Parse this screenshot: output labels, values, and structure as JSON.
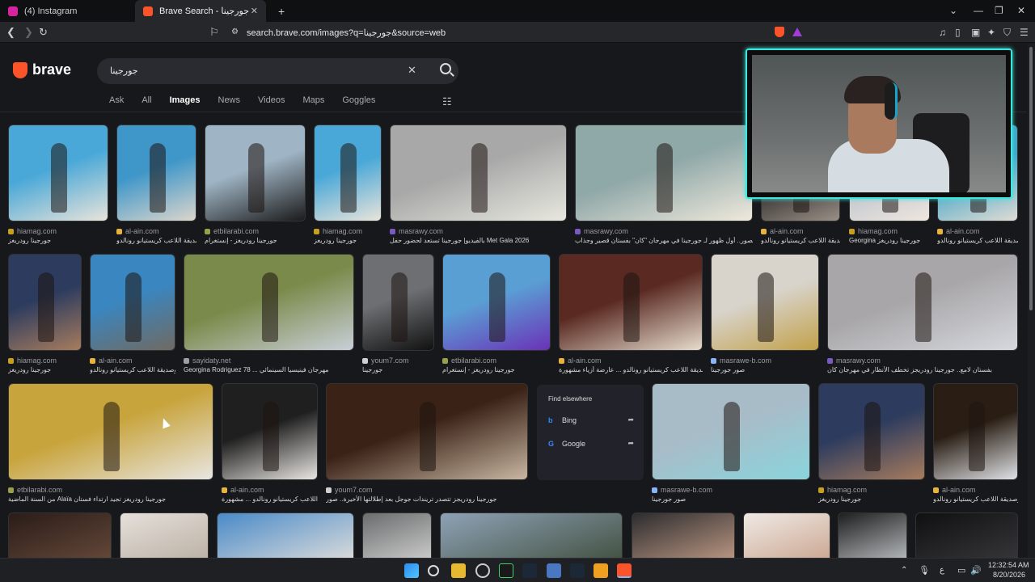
{
  "browser": {
    "tabs": [
      {
        "label": "(4) Instagram",
        "fav_color": "#d6249f"
      },
      {
        "label": "Brave Search - جورجينا",
        "fav_color": "#fb542b"
      }
    ],
    "url": "search.brave.com/images?q=جورجينا&source=web"
  },
  "search": {
    "logo": "brave",
    "query": "جورجينا",
    "tabs": [
      "Ask",
      "All",
      "Images",
      "News",
      "Videos",
      "Maps",
      "Goggles"
    ],
    "active_tab": "Images"
  },
  "results": [
    {
      "source": "hiamag.com",
      "title": "جورجينا رودريغز",
      "fav": "#c8a01e",
      "colors": [
        "#4aa8d8",
        "#e9e4da"
      ]
    },
    {
      "source": "al-ain.com",
      "title": "وصديقة اللاعب كريستيانو رونالدو",
      "fav": "#e8b33c",
      "colors": [
        "#3e96c9",
        "#dcd6cc"
      ]
    },
    {
      "source": "etbilarabi.com",
      "title": "جورجينا رودريغز - إنستغرام",
      "fav": "#9aa04a",
      "colors": [
        "#9fb4c4",
        "#1b1b1b"
      ]
    },
    {
      "source": "hiamag.com",
      "title": "جورجينا رودريغز",
      "fav": "#c8a01e",
      "colors": [
        "#4aa8d8",
        "#e9e4da"
      ]
    },
    {
      "source": "masrawy.com",
      "title": "بالفيديو| جورجينا تستعد لحضور حفل Met Gala 2026",
      "fav": "#7a5ac2",
      "colors": [
        "#a8a8a8",
        "#e8e8e0"
      ]
    },
    {
      "source": "masrawy.com",
      "title": "بالصور.. أول ظهور لـ جورجينا في مهرجان \"كان\" بفستان قصير وجذاب",
      "fav": "#7a5ac2",
      "colors": [
        "#8fa8a8",
        "#efe9dc"
      ]
    },
    {
      "source": "al-ain.com",
      "title": "وصديقة اللاعب كريستيانو رونالدو",
      "fav": "#e8b33c",
      "colors": [
        "#222222",
        "#9a8f86"
      ]
    },
    {
      "source": "hiamag.com",
      "title": "Georgina جورجينا رودريغز",
      "fav": "#c8a01e",
      "colors": [
        "#b8c0cc",
        "#efe6de"
      ]
    },
    {
      "source": "al-ain.com",
      "title": "وصديقة اللاعب كريستيانو رونالدو",
      "fav": "#e8b33c",
      "colors": [
        "#3ea4c8",
        "#e0dcd4"
      ]
    },
    {
      "source": "hiamag.com",
      "title": "جورجينا رودريغز",
      "fav": "#c8a01e",
      "colors": [
        "#2c3b5e",
        "#a77c5e"
      ]
    },
    {
      "source": "al-ain.com",
      "title": "وصديقة اللاعب كريستيانو رونالدو ...",
      "fav": "#e8b33c",
      "colors": [
        "#3a86c0",
        "#6f6a62"
      ]
    },
    {
      "source": "sayidaty.net",
      "title": "Georgina Rodriguez 78 ... مهرجان فينيسيا السينمائي",
      "fav": "#9aa0a6",
      "colors": [
        "#7a8a4a",
        "#c9cfd8"
      ]
    },
    {
      "source": "youm7.com",
      "title": "جورجينا",
      "fav": "#d0d0d0",
      "colors": [
        "#6d6f72",
        "#111111"
      ]
    },
    {
      "source": "etbilarabi.com",
      "title": "جورجينا رودريغز - إنستغرام",
      "fav": "#9aa04a",
      "colors": [
        "#5a9fd4",
        "#6a32b8"
      ]
    },
    {
      "source": "al-ain.com",
      "title": "وصديقة اللاعب كريستيانو رونالدو ... عارضة أزياء مشهورة",
      "fav": "#e8b33c",
      "colors": [
        "#5a2a22",
        "#e6dccd"
      ]
    },
    {
      "source": "masrawe-b.com",
      "title": "صور جورجينا",
      "fav": "#8ab4f8",
      "colors": [
        "#d8d4cc",
        "#c2a14a"
      ]
    },
    {
      "source": "masrawy.com",
      "title": "بفستان لامع.. جورجينا رودريجز تخطف الأنظار في مهرجان كان",
      "fav": "#7a5ac2",
      "colors": [
        "#a8a6a8",
        "#d6d8de"
      ]
    },
    {
      "source": "etbilarabi.com",
      "title": "من السنة الماضية Alaïa جورجينا رودريغز تجيد ارتداء فستان",
      "fav": "#9aa04a",
      "colors": [
        "#c8a43c",
        "#e8e6e2"
      ]
    },
    {
      "source": "al-ain.com",
      "title": "وصديقة اللاعب كريستيانو رونالدو ... مشهورة",
      "fav": "#e8b33c",
      "colors": [
        "#1f1f1f",
        "#e9e6e2"
      ]
    },
    {
      "source": "youm7.com",
      "title": "جورجينا رودريجز تتصدر تريندات جوجل بعد إطلالتها الأخيرة.. صور",
      "fav": "#d0d0d0",
      "colors": [
        "#3a2216",
        "#c8b6a2"
      ]
    },
    {
      "source": "masrawe-b.com",
      "title": "صور جورجينا",
      "fav": "#8ab4f8",
      "colors": [
        "#a8bcc8",
        "#8ad4dc"
      ]
    },
    {
      "source": "hiamag.com",
      "title": "جورجينا رودريغز",
      "fav": "#c8a01e",
      "colors": [
        "#2c3b5e",
        "#a77c5e"
      ]
    },
    {
      "source": "al-ain.com",
      "title": "وصديقة اللاعب كريستيانو رونالدو",
      "fav": "#e8b33c",
      "colors": [
        "#2a1e14",
        "#e0e2e6"
      ]
    }
  ],
  "find_elsewhere": {
    "title": "Find elsewhere",
    "items": [
      {
        "label": "Bing",
        "icon": "b"
      },
      {
        "label": "Google",
        "icon": "G"
      }
    ]
  },
  "bottom_row_colors": [
    [
      "#2a1c18",
      "#6a4c3c"
    ],
    [
      "#e4e0da",
      "#b8aca0"
    ],
    [
      "#4a8ac8",
      "#e6e2dc"
    ],
    [
      "#6a6c6e",
      "#d6d6d4"
    ],
    [
      "#8ea2b6",
      "#3e4c3a"
    ],
    [
      "#2c2c2e",
      "#c8a08a"
    ],
    [
      "#efeae4",
      "#c8a08a"
    ],
    [
      "#1e1e20",
      "#c6cacc"
    ],
    [
      "#101012",
      "#3a3a3c"
    ]
  ],
  "taskbar": {
    "lang": "ع",
    "time": "12:32:54 AM",
    "date": "8/20/2026"
  }
}
